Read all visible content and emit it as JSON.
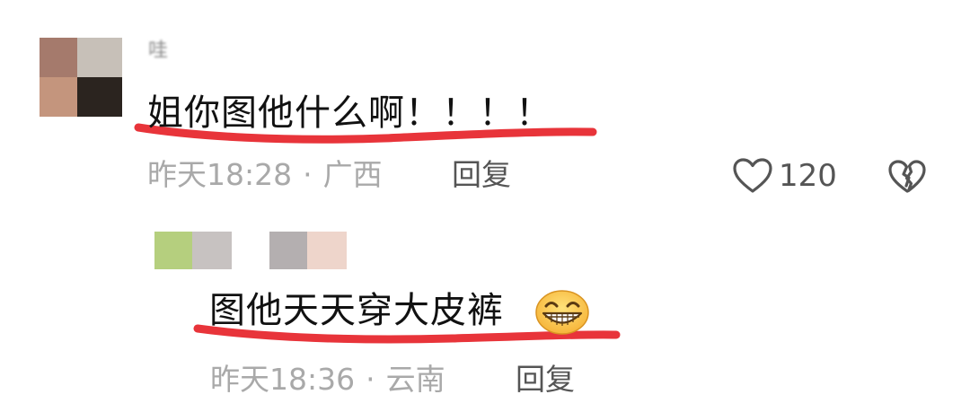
{
  "colors": {
    "underline_red": "#e8343a",
    "meta_gray": "#a9a9a9",
    "text_dark": "#111111",
    "action_gray": "#555555"
  },
  "comment": {
    "username": "哇",
    "avatar_colors": [
      "#a57a6c",
      "#c7c0b8",
      "#c4957d",
      "#2b241f"
    ],
    "text": "姐你图他什么啊！！！！",
    "time": "昨天18:28",
    "separator": "·",
    "location": "广西",
    "reply_label": "回复",
    "like_icon": "heart-outline-icon",
    "likes": "120",
    "dislike_icon": "broken-heart-icon"
  },
  "reply": {
    "avatar_colors": [
      "#b5cf7e",
      "#c7c2c1",
      "#b4afb0",
      "#eed5cb"
    ],
    "text": "图他天天穿大皮裤",
    "emoji": "grinning-face-emoji",
    "time": "昨天18:36",
    "separator": "·",
    "location": "云南",
    "reply_label": "回复"
  }
}
